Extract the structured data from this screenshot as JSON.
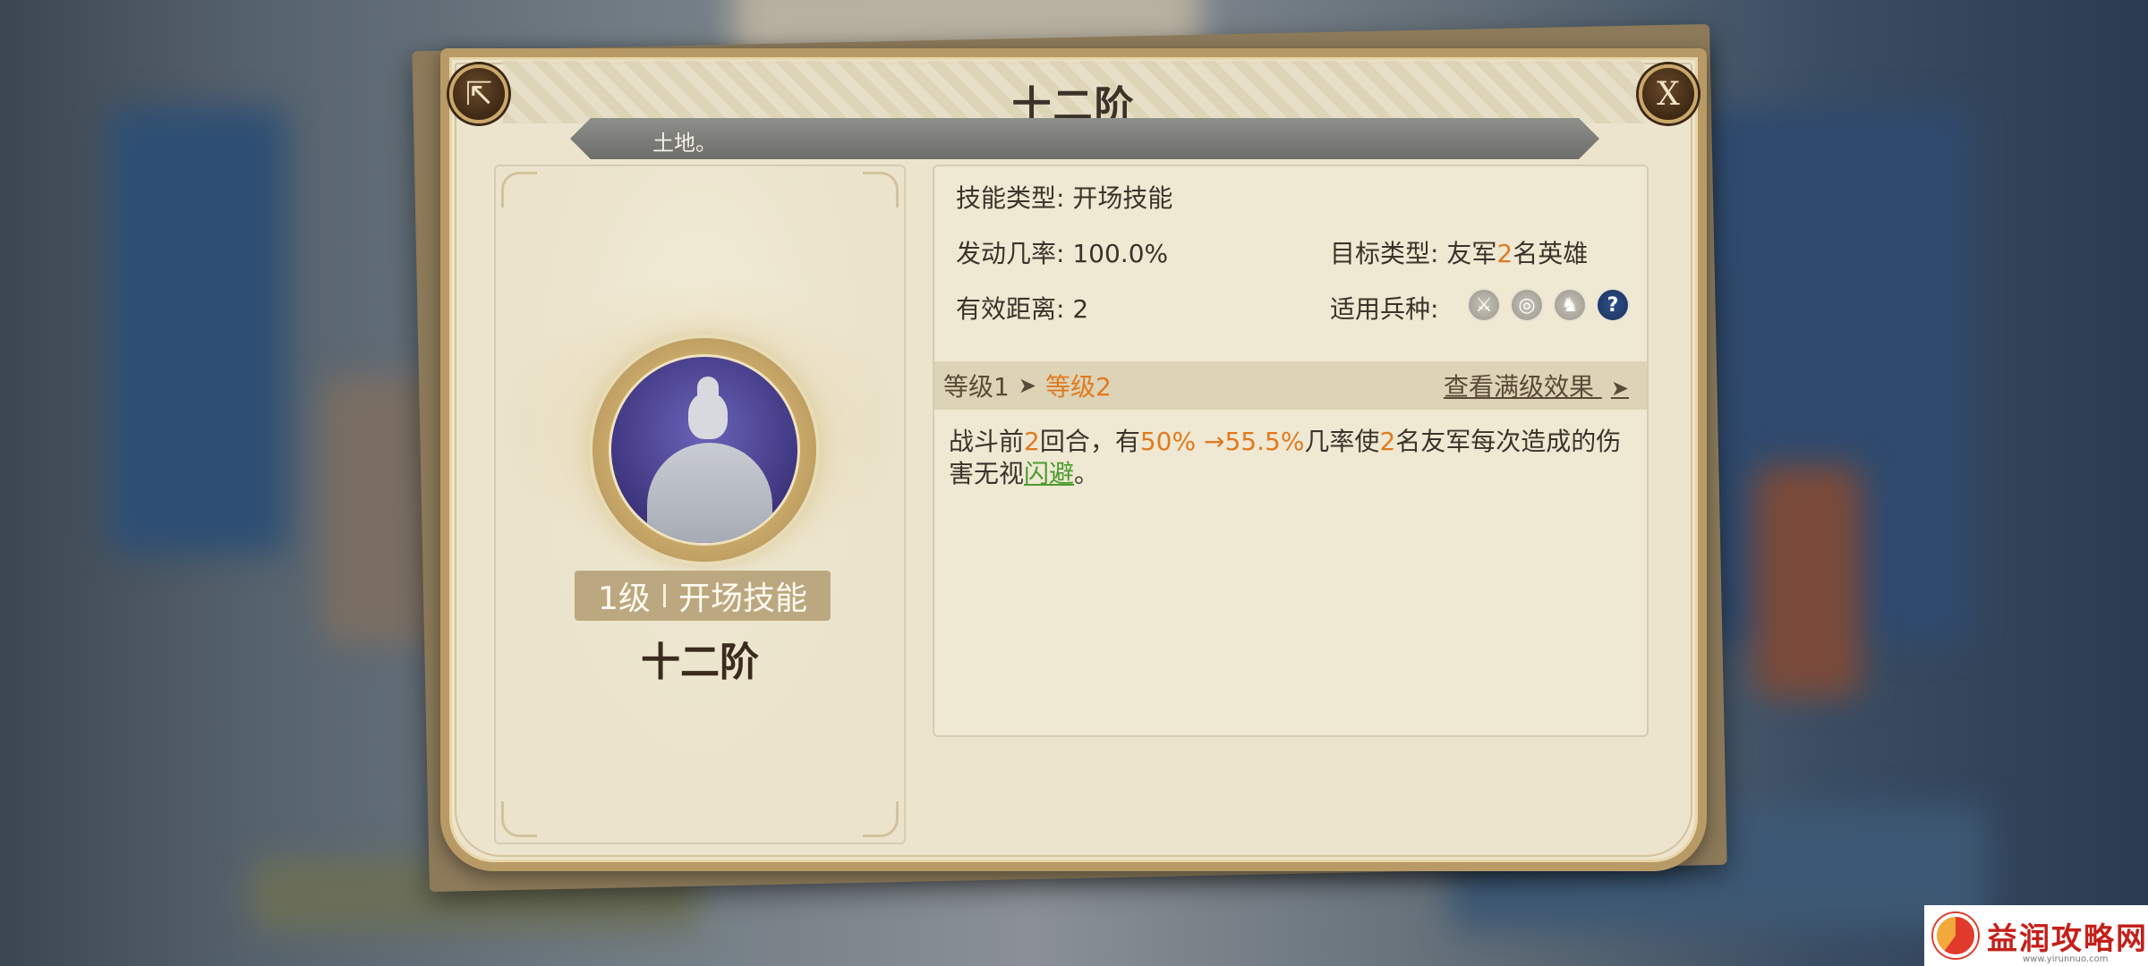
{
  "dialog": {
    "title": "十二阶",
    "ribbon_text": "土地。",
    "share_icon": "⇱",
    "close_label": "X"
  },
  "skill": {
    "level_badge": "1级",
    "type_badge": "开场技能",
    "name": "十二阶"
  },
  "stats": {
    "skill_type_label": "技能类型:",
    "skill_type_value": "开场技能",
    "trigger_rate_label": "发动几率:",
    "trigger_rate_value": "100.0%",
    "range_label": "有效距离:",
    "range_value": "2",
    "target_label": "目标类型:",
    "target_prefix": "友军",
    "target_count": "2",
    "target_suffix": "名英雄",
    "troop_label": "适用兵种:",
    "troop_icons": [
      "sword-icon",
      "bow-target-icon",
      "cavalry-horse-icon",
      "question-icon"
    ]
  },
  "level": {
    "from": "等级1",
    "arrow": "➤",
    "to": "等级2",
    "full_effect": "查看满级效果",
    "full_arrow": "➤"
  },
  "description": {
    "p1": "战斗前",
    "rounds": "2",
    "p2": "回合，有",
    "rate_from": "50%",
    "arrow": " →",
    "rate_to": "55.5%",
    "p3": "几率使",
    "allies": "2",
    "p4": "名友军每次造成的伤害无视",
    "keyword": "闪避",
    "p5": "。"
  },
  "watermark": {
    "text": "益润攻略网",
    "url": "www.yirunnuo.com"
  },
  "colors": {
    "highlight_orange": "#e07a1f",
    "highlight_green": "#4c9b2e",
    "frame_gold": "#b89a66",
    "parchment": "#ece4cd"
  }
}
